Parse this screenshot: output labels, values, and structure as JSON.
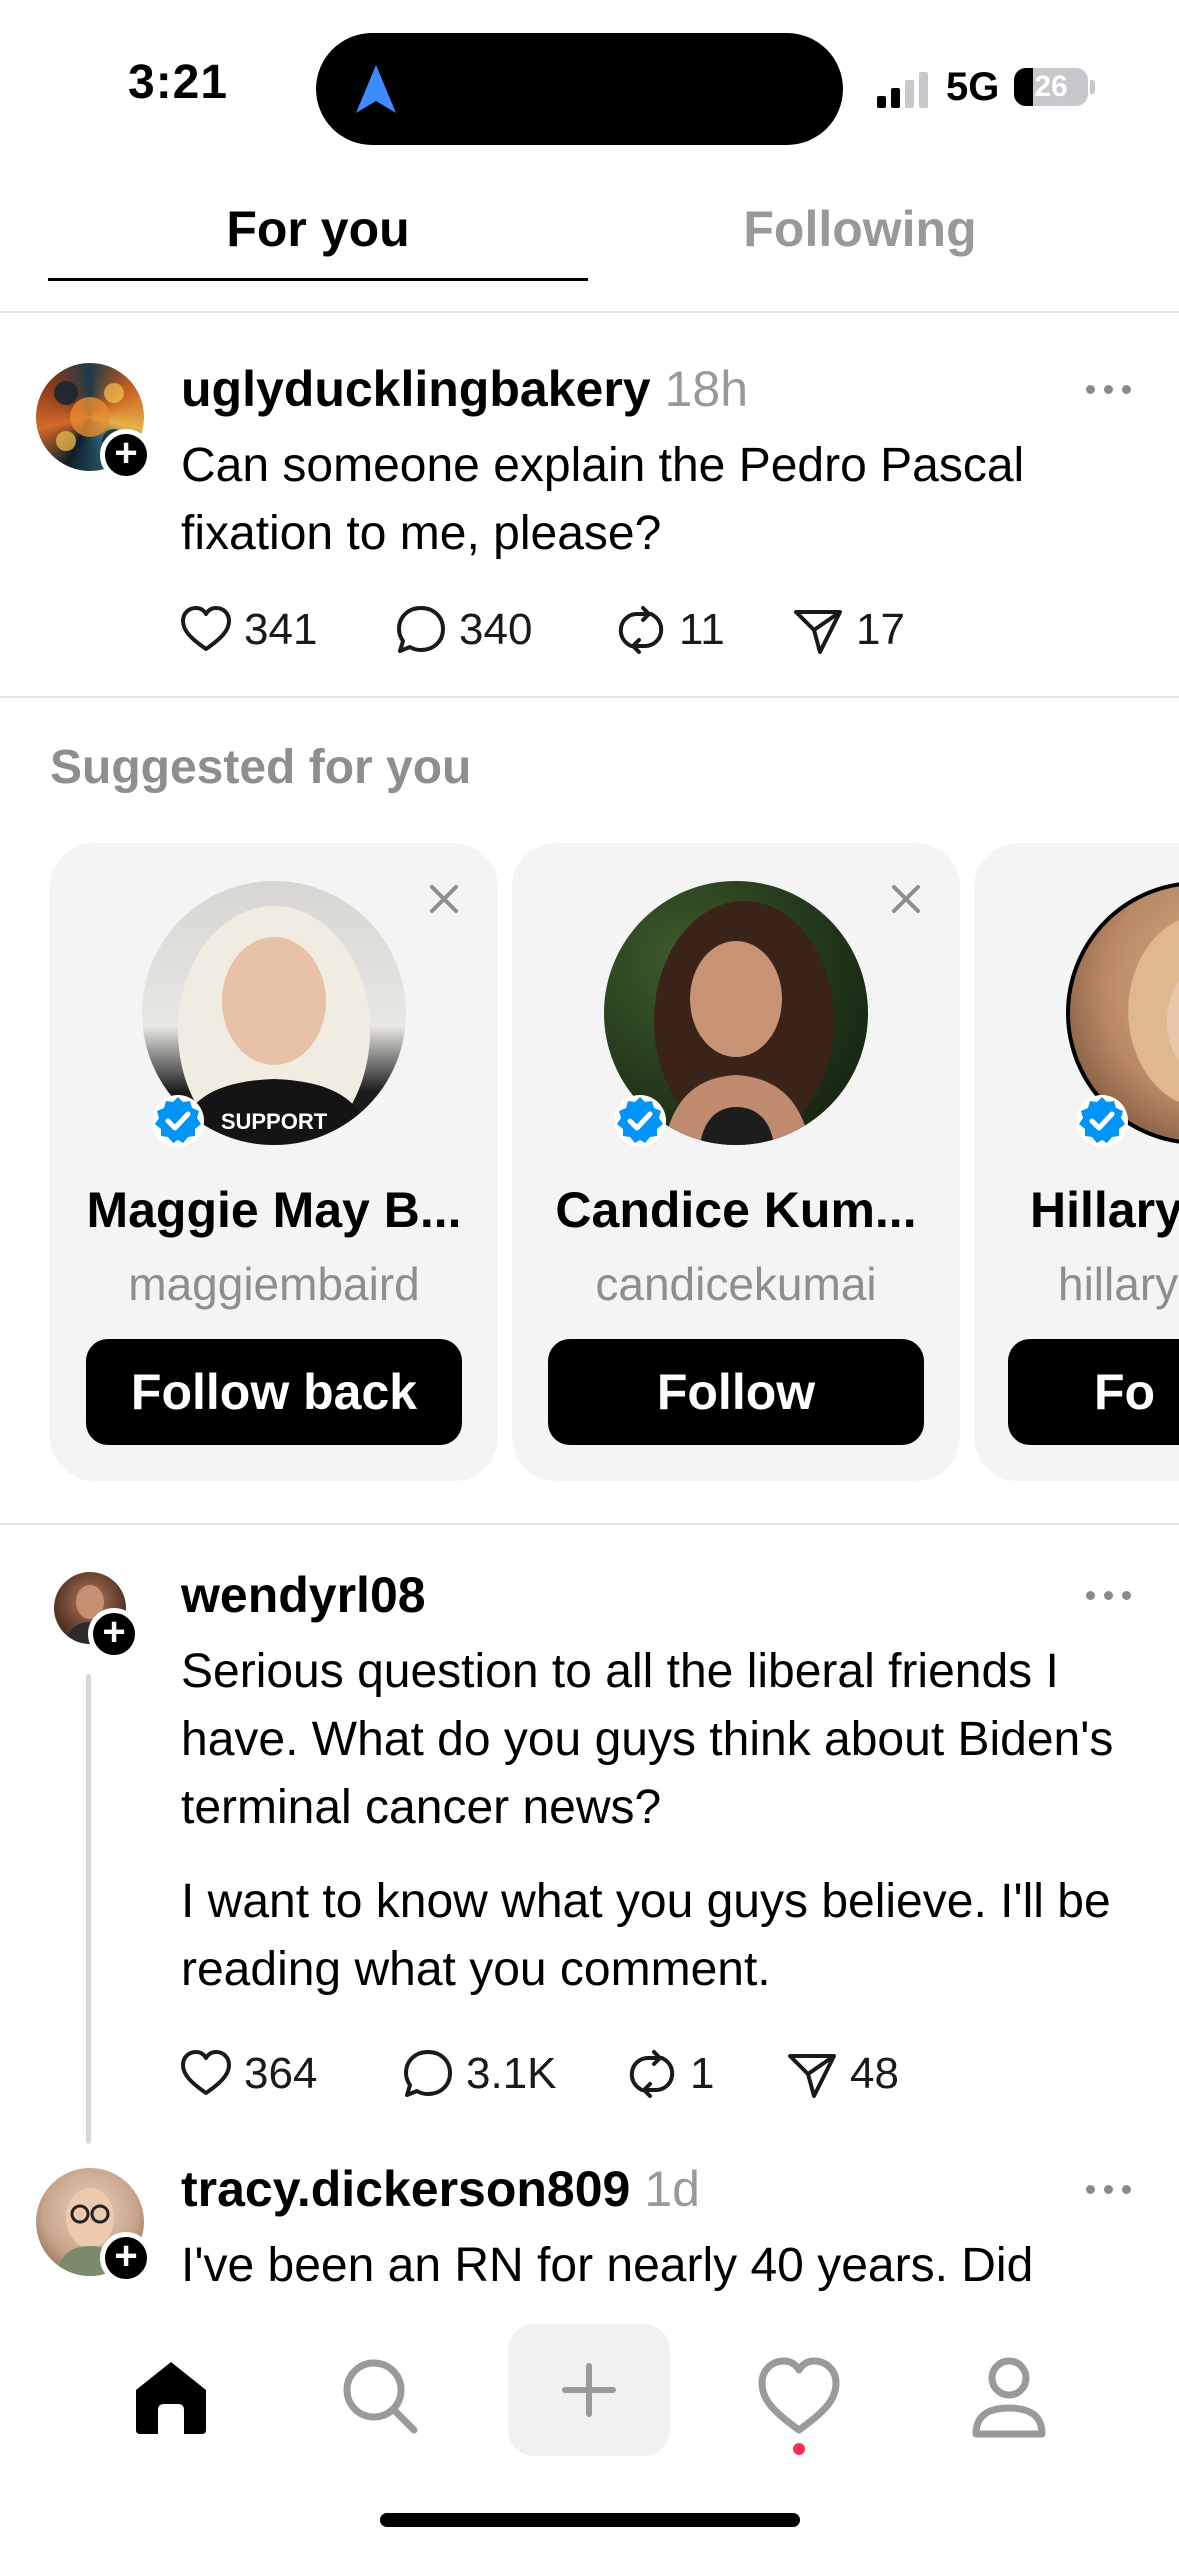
{
  "status_bar": {
    "time": "3:21",
    "network": "5G",
    "battery": "26",
    "battery_level_percent": 26
  },
  "tabs": [
    {
      "label": "For you",
      "active": true
    },
    {
      "label": "Following",
      "active": false
    }
  ],
  "posts": [
    {
      "username": "uglyducklingbakery",
      "time": "18h",
      "paragraphs": [
        "Can someone explain the Pedro Pascal fixation to me, please?"
      ],
      "likes": "341",
      "replies": "340",
      "reposts": "11",
      "shares": "17"
    },
    {
      "username": "wendyrl08",
      "time": "",
      "paragraphs": [
        "Serious question to all the liberal friends I have. What do you guys think about Biden's terminal cancer news?",
        "I want to know what you guys believe. I'll be reading what you comment."
      ],
      "likes": "364",
      "replies": "3.1K",
      "reposts": "1",
      "shares": "48"
    },
    {
      "username": "tracy.dickerson809",
      "time": "1d",
      "paragraphs": [
        "I've been an RN for nearly 40 years. Did"
      ]
    }
  ],
  "suggested": {
    "title": "Suggested for you",
    "cards": [
      {
        "name": "Maggie May B...",
        "handle": "maggiembaird",
        "button": "Follow back",
        "verified": true
      },
      {
        "name": "Candice Kum...",
        "handle": "candicekumai",
        "button": "Follow",
        "verified": true
      },
      {
        "name": "Hillary",
        "handle": "hillary",
        "button": "Fo",
        "verified": true
      }
    ]
  },
  "bottom_nav": {
    "items": [
      "home-icon",
      "search-icon",
      "create-icon",
      "activity-icon",
      "profile-icon"
    ],
    "activity_badge": true
  },
  "colors": {
    "accent_verified": "#0095f6",
    "notification_dot": "#ff2d55",
    "secondary_text": "#999999",
    "card_background": "#f4f4f4"
  }
}
